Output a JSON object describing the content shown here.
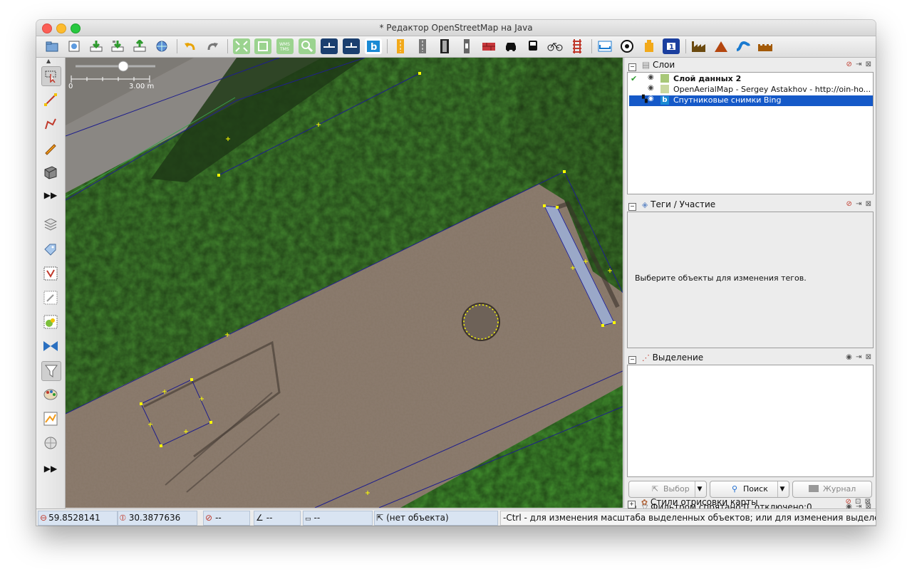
{
  "window": {
    "title": "* Редактор OpenStreetMap на Java"
  },
  "map": {
    "scale_label_left": "0",
    "scale_label_right": "3.00 m",
    "colors": {
      "ways": "#1e1e8c",
      "nodes": "#ffff00",
      "grass": "#3f7e2c",
      "ground": "#8c7c6f"
    }
  },
  "layers_panel": {
    "title": "Слои",
    "layers": [
      {
        "name": "Слой данных 2",
        "bold": true,
        "selected": false
      },
      {
        "name": "OpenAerialMap - Sergey Astakhov - http://oin-ho...",
        "bold": false,
        "selected": false
      },
      {
        "name": "Спутниковые снимки Bing",
        "bold": false,
        "selected": true
      }
    ]
  },
  "tags_panel": {
    "title": "Теги / Участие",
    "message": "Выберите объекты для изменения тегов."
  },
  "selection_panel": {
    "title": "Выделение",
    "buttons": {
      "select": "Выбор",
      "search": "Поиск",
      "history": "Журнал"
    }
  },
  "filter_panel": {
    "title": "Фильтром спрятано:0, отключено:0"
  },
  "styles_panel": {
    "title": "Стили отрисовки карты"
  },
  "status": {
    "lat": "59.8528141",
    "lon": "30.3877636",
    "heading": "--",
    "angle": "--",
    "length": "--",
    "object": "(нет объекта)",
    "hint": "-Ctrl - для изменения масштаба выделенных объектов; или для изменения выделения"
  }
}
